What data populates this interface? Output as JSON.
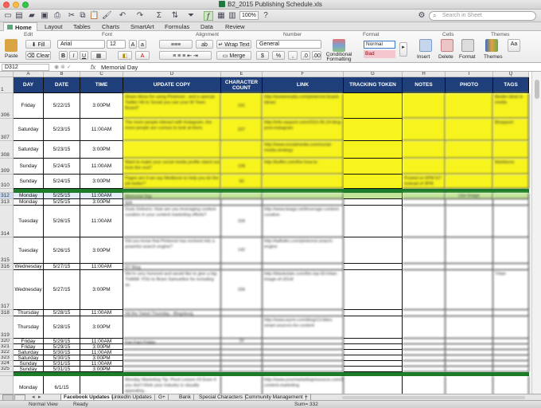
{
  "window": {
    "title": "B2_2015 Publishing Schedule.xls"
  },
  "toolbar": {
    "zoom": "100%",
    "search_placeholder": "Search in Sheet"
  },
  "ribbon_tabs": [
    "Home",
    "Layout",
    "Tables",
    "Charts",
    "SmartArt",
    "Formulas",
    "Data",
    "Review"
  ],
  "ribbon": {
    "groups": {
      "edit": "Edit",
      "font": "Font",
      "alignment": "Alignment",
      "number": "Number",
      "format": "Format",
      "cells": "Cells",
      "themes": "Themes"
    },
    "paste": "Paste",
    "fill": "Fill",
    "clear": "Clear",
    "font_name": "Arial",
    "font_size": "12",
    "wrap_text": "Wrap Text",
    "merge": "Merge",
    "number_format": "General",
    "conditional_formatting": "Conditional Formatting",
    "style_normal": "Normal",
    "style_bad": "Bad",
    "insert": "Insert",
    "delete": "Delete",
    "format": "Format",
    "themes": "Themes"
  },
  "formula_bar": {
    "name_box": "D312",
    "fx": "fx",
    "content": "Memorial Day"
  },
  "columns": {
    "letters": [
      "A",
      "B",
      "C",
      "D",
      "E",
      "F",
      "G",
      "H",
      "I",
      "Q"
    ],
    "headers": [
      "DAY",
      "DATE",
      "TIME",
      "UPDATE COPY",
      "CHARACTER COUNT",
      "LINK",
      "TRACKING TOKEN",
      "NOTES",
      "PHOTO",
      "TAGS"
    ]
  },
  "rows": [
    {
      "num": "306",
      "day": "Friday",
      "date": "5/22/15",
      "time": "3:00PM",
      "copy": "Share ideas for using Pinterest - and a special Twitter Hit to Social you use your W Town Board?",
      "count": "191",
      "link": "http://wwwmeadu.com/pinterest-board-ideas/",
      "notes": "",
      "photo": "",
      "tags": "Bieder ideal re media",
      "style": "yellow"
    },
    {
      "num": "307",
      "day": "Saturday",
      "date": "5/23/15",
      "time": "11:00AM",
      "copy": "The more people interact with Instagram, the more people are curious to look at them.",
      "count": "207",
      "link": "http://info.sqsport.com/2015-05-24-blog-post-instagram",
      "notes": "",
      "photo": "",
      "tags": "Bloqsport",
      "style": "yellow"
    },
    {
      "num": "308",
      "day": "Saturday",
      "date": "5/23/15",
      "time": "3:00PM",
      "copy": "",
      "count": "",
      "link": "http://www.socialmedia.com/social-media-strategy",
      "notes": "",
      "photo": "",
      "tags": "",
      "style": "yellow"
    },
    {
      "num": "309",
      "day": "Sunday",
      "date": "5/24/15",
      "time": "11:00AM",
      "copy": "Want to make your social media profile stand out from the rest?",
      "count": "109",
      "link": "http://buffer.com/the-how-to",
      "notes": "",
      "photo": "",
      "tags": "Markbone",
      "style": "yellow"
    },
    {
      "num": "310",
      "day": "Sunday",
      "date": "5/24/15",
      "time": "3:00PM",
      "copy": "Pages are it we say Medbone to help you do the job better?",
      "count": "93",
      "link": "",
      "notes": "Posted on 6PM 5/7 instead of 3PM",
      "photo": "",
      "tags": "",
      "style": "yellow"
    },
    {
      "num": "312",
      "day": "Monday",
      "date": "5/25/15",
      "time": "11:00AM",
      "copy": "Memorial Day",
      "count": "",
      "link": "",
      "notes": "",
      "photo": "Use Image",
      "tags": "",
      "style": "ltgreen"
    },
    {
      "num": "313",
      "day": "Monday",
      "date": "5/25/15",
      "time": "3:00PM",
      "copy": "N/A",
      "count": "",
      "link": "",
      "notes": "",
      "photo": "",
      "tags": "",
      "style": ""
    },
    {
      "num": "314",
      "day": "Tuesday",
      "date": "5/26/15",
      "time": "11:00AM",
      "copy": "Dusk Delivers: How are you leveraging content curation in your content marketing efforts?",
      "count": "209",
      "link": "http://www.twago.net/leverage-content-curation",
      "notes": "",
      "photo": "",
      "tags": "",
      "style": ""
    },
    {
      "num": "315",
      "day": "Tuesday",
      "date": "5/26/15",
      "time": "3:00PM",
      "copy": "Did you know that Pinterest has evolved into a powerful search engine?",
      "count": "142",
      "link": "http://tailfulkn.com/pinterest-search-engine",
      "notes": "",
      "photo": "",
      "tags": "",
      "style": ""
    },
    {
      "num": "316",
      "day": "Wednesday",
      "date": "5/27/15",
      "time": "11:00AM",
      "copy": "RT Blog",
      "count": "",
      "link": "",
      "notes": "",
      "photo": "",
      "tags": "",
      "style": ""
    },
    {
      "num": "317",
      "day": "Wednesday",
      "date": "5/27/15",
      "time": "3:00PM",
      "copy": "We're very honored and would like to give a big THANK YOU to Bram Samuelton for including us.",
      "count": "206",
      "link": "http://blankslate.com/the-top-50-tritan-image-of-2014/",
      "notes": "",
      "photo": "",
      "tags": "Tritan",
      "style": ""
    },
    {
      "num": "318",
      "day": "Thursday",
      "date": "5/28/15",
      "time": "11:00AM",
      "copy": "Hit the Tweet Thursday : Blogsburg",
      "count": "",
      "link": "",
      "notes": "",
      "photo": "",
      "tags": "",
      "style": ""
    },
    {
      "num": "319",
      "day": "Thursday",
      "date": "5/28/15",
      "time": "3:00PM",
      "copy": "",
      "count": "",
      "link": "http://www.wyrm.com/blog/13-bites-smart-sources-for-content",
      "notes": "",
      "photo": "",
      "tags": "",
      "style": ""
    },
    {
      "num": "320",
      "day": "Friday",
      "date": "5/29/15",
      "time": "11:00AM",
      "copy": "Fun Fact Friday",
      "count": "29",
      "link": "",
      "notes": "",
      "photo": "",
      "tags": "",
      "style": ""
    },
    {
      "num": "321",
      "day": "Friday",
      "date": "5/29/15",
      "time": "3:00PM",
      "copy": "",
      "count": "",
      "link": "",
      "notes": "",
      "photo": "",
      "tags": "",
      "style": ""
    },
    {
      "num": "322",
      "day": "Saturday",
      "date": "5/30/15",
      "time": "11:00AM",
      "copy": "",
      "count": "",
      "link": "",
      "notes": "",
      "photo": "",
      "tags": "",
      "style": ""
    },
    {
      "num": "323",
      "day": "Saturday",
      "date": "5/30/15",
      "time": "3:00PM",
      "copy": "",
      "count": "",
      "link": "",
      "notes": "",
      "photo": "",
      "tags": "",
      "style": ""
    },
    {
      "num": "324",
      "day": "Sunday",
      "date": "5/31/15",
      "time": "11:00AM",
      "copy": "",
      "count": "",
      "link": "",
      "notes": "",
      "photo": "",
      "tags": "",
      "style": ""
    },
    {
      "num": "325",
      "day": "Sunday",
      "date": "5/31/15",
      "time": "3:00PM",
      "copy": "",
      "count": "",
      "link": "",
      "notes": "",
      "photo": "",
      "tags": "",
      "style": ""
    },
    {
      "num": "327",
      "day": "Monday",
      "date": "6/1/15",
      "time": "",
      "copy": "Monday Marketing Tip: Pivot Lesson #3 Even if you don't think your industry is visually appealing...",
      "count": "",
      "link": "http://www.yourmarketingresource.com/2015/06/tip-content-marketing",
      "notes": "",
      "photo": "",
      "tags": "",
      "style": ""
    }
  ],
  "sheet_tabs": [
    "Facebook Updates",
    "LinkedIn Updates",
    "G+",
    "Bank",
    "Special Characters",
    "Community Management",
    "+"
  ],
  "status": {
    "view": "Normal View",
    "ready": "Ready",
    "sum": "Sum= 332"
  },
  "colors": {
    "header_blue": "#1f3f7a",
    "highlight_yellow": "#f6f31d",
    "divider_green": "#1c7c2a",
    "light_green": "#c3e59a"
  }
}
